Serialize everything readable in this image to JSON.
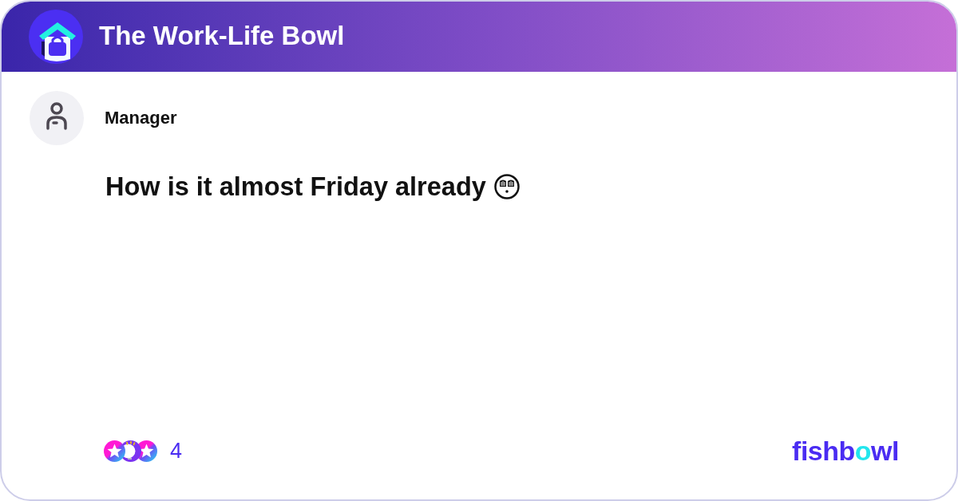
{
  "header": {
    "title": "The Work-Life Bowl"
  },
  "post": {
    "author": "Manager",
    "text": "How is it almost Friday already"
  },
  "reactions": {
    "count": "4"
  },
  "brand": {
    "parts": [
      {
        "text": "fishb",
        "accent": false
      },
      {
        "text": "o",
        "accent": true
      },
      {
        "text": "wl",
        "accent": false
      }
    ]
  }
}
